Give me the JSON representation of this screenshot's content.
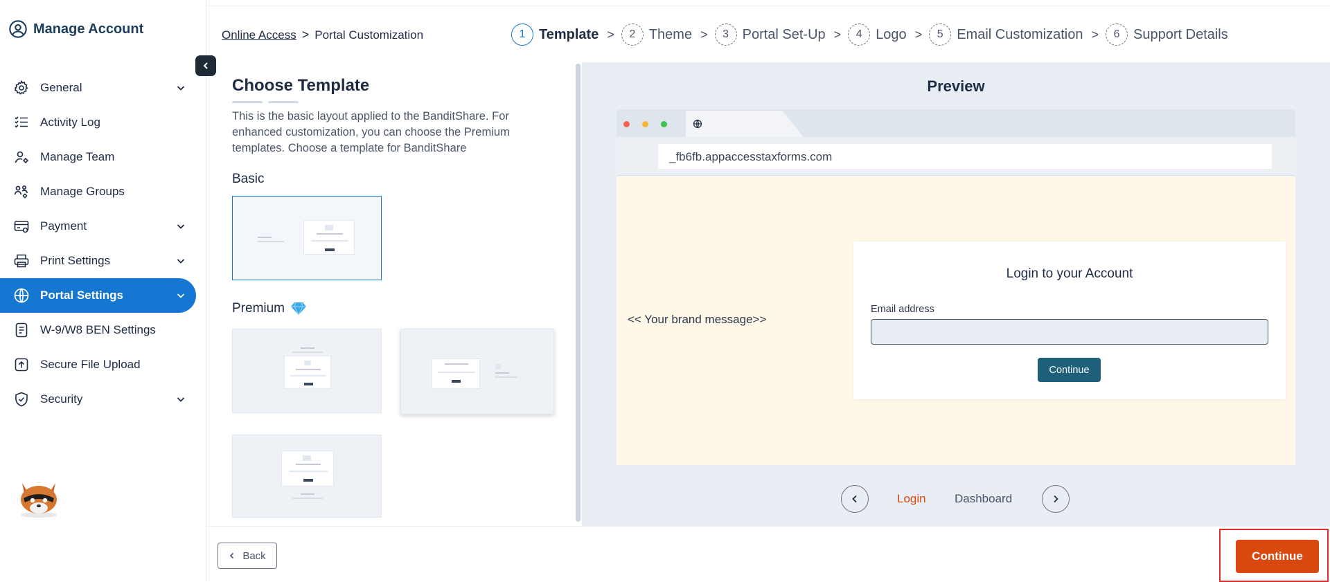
{
  "app": {
    "title": "Manage Account"
  },
  "sidebar": {
    "items": [
      {
        "label": "General",
        "icon": "gear-icon",
        "has_chevron": true
      },
      {
        "label": "Activity Log",
        "icon": "checklist-icon",
        "has_chevron": false
      },
      {
        "label": "Manage Team",
        "icon": "user-gear-icon",
        "has_chevron": false
      },
      {
        "label": "Manage Groups",
        "icon": "group-icon",
        "has_chevron": false
      },
      {
        "label": "Payment",
        "icon": "payment-card-icon",
        "has_chevron": true
      },
      {
        "label": "Print Settings",
        "icon": "printer-icon",
        "has_chevron": true
      },
      {
        "label": "Portal Settings",
        "icon": "globe-icon",
        "has_chevron": true,
        "active": true
      },
      {
        "label": "W-9/W8 BEN Settings",
        "icon": "document-icon",
        "has_chevron": false
      },
      {
        "label": "Secure File Upload",
        "icon": "upload-icon",
        "has_chevron": false
      },
      {
        "label": "Security",
        "icon": "shield-icon",
        "has_chevron": true
      }
    ]
  },
  "breadcrumb": {
    "parent": "Online Access",
    "separator": ">",
    "current": "Portal Customization"
  },
  "steps": [
    {
      "num": "1",
      "label": "Template",
      "current": true
    },
    {
      "num": "2",
      "label": "Theme"
    },
    {
      "num": "3",
      "label": "Portal Set-Up"
    },
    {
      "num": "4",
      "label": "Logo"
    },
    {
      "num": "5",
      "label": "Email Customization"
    },
    {
      "num": "6",
      "label": "Support Details"
    }
  ],
  "step_arrow": ">",
  "template_panel": {
    "title": "Choose Template",
    "description": "This is the basic layout applied to the BanditShare. For enhanced customization, you can choose the Premium templates. Choose a template for BanditShare",
    "basic_label": "Basic",
    "premium_label": "Premium",
    "premium_icon": "diamond-icon"
  },
  "preview": {
    "title": "Preview",
    "address": "_fb6fb.appaccesstaxforms.com",
    "brand_message": "<< Your brand message>>",
    "login_title": "Login to your Account",
    "email_label": "Email address",
    "email_value": "",
    "continue_label": "Continue",
    "tabs": [
      {
        "label": "Login",
        "active": true
      },
      {
        "label": "Dashboard",
        "active": false
      }
    ]
  },
  "footer": {
    "back_label": "Back",
    "continue_label": "Continue"
  },
  "colors": {
    "accent": "#1677d2",
    "cta": "#d9480f",
    "highlight_box": "#e02b2b",
    "preview_page": "#fff8e8",
    "login_button": "#1e5f7a"
  }
}
